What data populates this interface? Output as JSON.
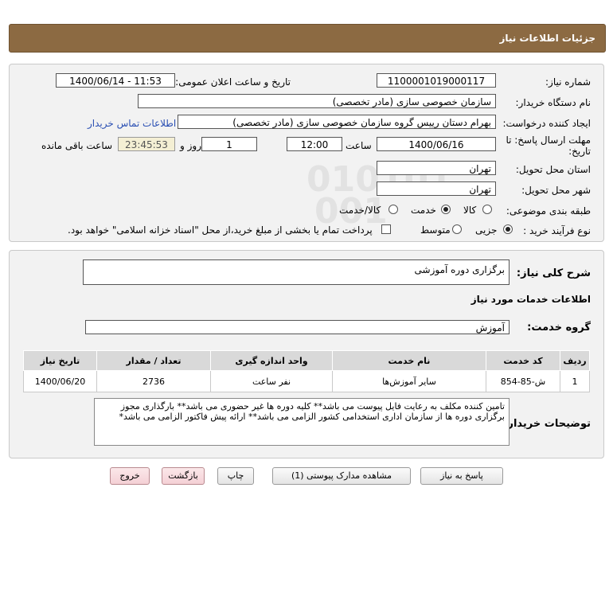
{
  "header": {
    "title": "جزئیات اطلاعات نیاز"
  },
  "form": {
    "need_number_label": "شماره نیاز:",
    "need_number": "1100001019000117",
    "announce_label": "تاریخ و ساعت اعلان عمومی:",
    "announce_value": "1400/06/14 - 11:53",
    "buyer_label": "نام دستگاه خریدار:",
    "buyer_value": "سازمان خصوصی سازی (مادر تخصصی)",
    "creator_label": "ایجاد کننده درخواست:",
    "creator_value": "بهرام دستان رییس گروه سازمان خصوصی سازی (مادر تخصصی)",
    "contact_link": "اطلاعات تماس خریدار",
    "deadline_label_1": "مهلت ارسال پاسخ: تا",
    "deadline_label_2": "تاریخ:",
    "deadline_date": "1400/06/16",
    "time_label": "ساعت",
    "deadline_time": "12:00",
    "days_value": "1",
    "days_label": "روز و",
    "remaining_time": "23:45:53",
    "remaining_label": "ساعت باقی مانده",
    "province_label": "استان محل تحویل:",
    "province_value": "تهران",
    "city_label": "شهر محل تحویل:",
    "city_value": "تهران",
    "category_label": "طبقه بندی موضوعی:",
    "category_options": [
      "کالا",
      "خدمت",
      "کالا/خدمت"
    ],
    "category_selected": 1,
    "process_label": "نوع فرآیند خرید :",
    "process_options": [
      "جزیی",
      "متوسط"
    ],
    "process_selected": 0,
    "payment_text": "پرداخت تمام یا بخشی از مبلغ خرید،از محل \"اسناد خزانه اسلامی\" خواهد بود."
  },
  "details": {
    "summary_label": "شرح کلی نیاز:",
    "summary_value": "برگزاری دوره آموزشی",
    "services_heading": "اطلاعات خدمات مورد نیاز",
    "service_group_label": "گروه خدمت:",
    "service_group_value": "آموزش",
    "table": {
      "headers": [
        "ردیف",
        "کد خدمت",
        "نام خدمت",
        "واحد اندازه گیری",
        "تعداد / مقدار",
        "تاریخ نیاز"
      ],
      "rows": [
        [
          "1",
          "ش-85-854",
          "سایر آموزش‌ها",
          "نفر ساعت",
          "2736",
          "1400/06/20"
        ]
      ]
    },
    "buyer_notes_label": "توضیحات خریدار:",
    "buyer_notes": "تامین کننده مکلف به رعایت فایل پیوست می باشد** کلیه دوره ها غیر حضوری می باشد** بارگذاری مجوز برگزاری دوره ها از سازمان اداری استخدامی کشور الزامی می باشد** ارائه پیش فاکتور الزامی می باشد*"
  },
  "buttons": {
    "reply": "پاسخ به نیاز",
    "attachments": "مشاهده مدارک پیوستی (1)",
    "print": "چاپ",
    "back": "بازگشت",
    "exit": "خروج"
  }
}
